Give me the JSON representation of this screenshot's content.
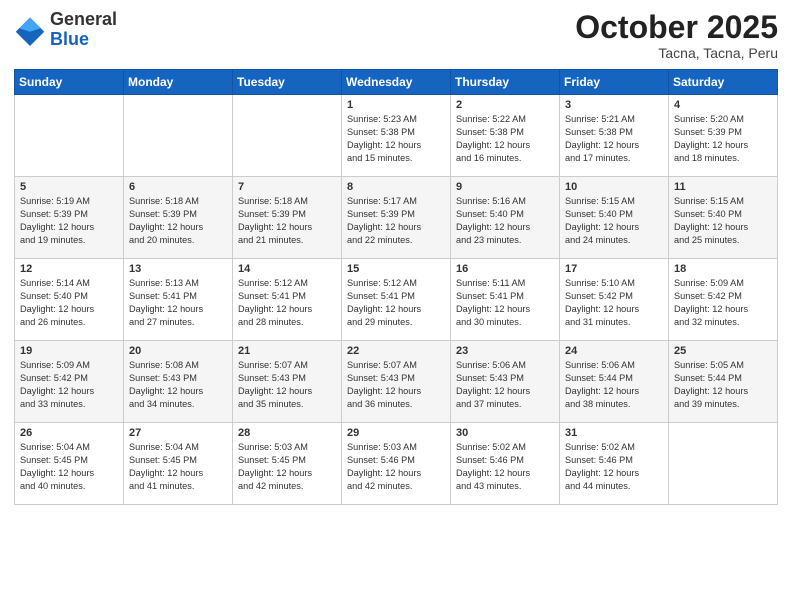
{
  "header": {
    "logo_general": "General",
    "logo_blue": "Blue",
    "month": "October 2025",
    "location": "Tacna, Tacna, Peru"
  },
  "weekdays": [
    "Sunday",
    "Monday",
    "Tuesday",
    "Wednesday",
    "Thursday",
    "Friday",
    "Saturday"
  ],
  "weeks": [
    [
      {
        "day": "",
        "info": ""
      },
      {
        "day": "",
        "info": ""
      },
      {
        "day": "",
        "info": ""
      },
      {
        "day": "1",
        "info": "Sunrise: 5:23 AM\nSunset: 5:38 PM\nDaylight: 12 hours\nand 15 minutes."
      },
      {
        "day": "2",
        "info": "Sunrise: 5:22 AM\nSunset: 5:38 PM\nDaylight: 12 hours\nand 16 minutes."
      },
      {
        "day": "3",
        "info": "Sunrise: 5:21 AM\nSunset: 5:38 PM\nDaylight: 12 hours\nand 17 minutes."
      },
      {
        "day": "4",
        "info": "Sunrise: 5:20 AM\nSunset: 5:39 PM\nDaylight: 12 hours\nand 18 minutes."
      }
    ],
    [
      {
        "day": "5",
        "info": "Sunrise: 5:19 AM\nSunset: 5:39 PM\nDaylight: 12 hours\nand 19 minutes."
      },
      {
        "day": "6",
        "info": "Sunrise: 5:18 AM\nSunset: 5:39 PM\nDaylight: 12 hours\nand 20 minutes."
      },
      {
        "day": "7",
        "info": "Sunrise: 5:18 AM\nSunset: 5:39 PM\nDaylight: 12 hours\nand 21 minutes."
      },
      {
        "day": "8",
        "info": "Sunrise: 5:17 AM\nSunset: 5:39 PM\nDaylight: 12 hours\nand 22 minutes."
      },
      {
        "day": "9",
        "info": "Sunrise: 5:16 AM\nSunset: 5:40 PM\nDaylight: 12 hours\nand 23 minutes."
      },
      {
        "day": "10",
        "info": "Sunrise: 5:15 AM\nSunset: 5:40 PM\nDaylight: 12 hours\nand 24 minutes."
      },
      {
        "day": "11",
        "info": "Sunrise: 5:15 AM\nSunset: 5:40 PM\nDaylight: 12 hours\nand 25 minutes."
      }
    ],
    [
      {
        "day": "12",
        "info": "Sunrise: 5:14 AM\nSunset: 5:40 PM\nDaylight: 12 hours\nand 26 minutes."
      },
      {
        "day": "13",
        "info": "Sunrise: 5:13 AM\nSunset: 5:41 PM\nDaylight: 12 hours\nand 27 minutes."
      },
      {
        "day": "14",
        "info": "Sunrise: 5:12 AM\nSunset: 5:41 PM\nDaylight: 12 hours\nand 28 minutes."
      },
      {
        "day": "15",
        "info": "Sunrise: 5:12 AM\nSunset: 5:41 PM\nDaylight: 12 hours\nand 29 minutes."
      },
      {
        "day": "16",
        "info": "Sunrise: 5:11 AM\nSunset: 5:41 PM\nDaylight: 12 hours\nand 30 minutes."
      },
      {
        "day": "17",
        "info": "Sunrise: 5:10 AM\nSunset: 5:42 PM\nDaylight: 12 hours\nand 31 minutes."
      },
      {
        "day": "18",
        "info": "Sunrise: 5:09 AM\nSunset: 5:42 PM\nDaylight: 12 hours\nand 32 minutes."
      }
    ],
    [
      {
        "day": "19",
        "info": "Sunrise: 5:09 AM\nSunset: 5:42 PM\nDaylight: 12 hours\nand 33 minutes."
      },
      {
        "day": "20",
        "info": "Sunrise: 5:08 AM\nSunset: 5:43 PM\nDaylight: 12 hours\nand 34 minutes."
      },
      {
        "day": "21",
        "info": "Sunrise: 5:07 AM\nSunset: 5:43 PM\nDaylight: 12 hours\nand 35 minutes."
      },
      {
        "day": "22",
        "info": "Sunrise: 5:07 AM\nSunset: 5:43 PM\nDaylight: 12 hours\nand 36 minutes."
      },
      {
        "day": "23",
        "info": "Sunrise: 5:06 AM\nSunset: 5:43 PM\nDaylight: 12 hours\nand 37 minutes."
      },
      {
        "day": "24",
        "info": "Sunrise: 5:06 AM\nSunset: 5:44 PM\nDaylight: 12 hours\nand 38 minutes."
      },
      {
        "day": "25",
        "info": "Sunrise: 5:05 AM\nSunset: 5:44 PM\nDaylight: 12 hours\nand 39 minutes."
      }
    ],
    [
      {
        "day": "26",
        "info": "Sunrise: 5:04 AM\nSunset: 5:45 PM\nDaylight: 12 hours\nand 40 minutes."
      },
      {
        "day": "27",
        "info": "Sunrise: 5:04 AM\nSunset: 5:45 PM\nDaylight: 12 hours\nand 41 minutes."
      },
      {
        "day": "28",
        "info": "Sunrise: 5:03 AM\nSunset: 5:45 PM\nDaylight: 12 hours\nand 42 minutes."
      },
      {
        "day": "29",
        "info": "Sunrise: 5:03 AM\nSunset: 5:46 PM\nDaylight: 12 hours\nand 42 minutes."
      },
      {
        "day": "30",
        "info": "Sunrise: 5:02 AM\nSunset: 5:46 PM\nDaylight: 12 hours\nand 43 minutes."
      },
      {
        "day": "31",
        "info": "Sunrise: 5:02 AM\nSunset: 5:46 PM\nDaylight: 12 hours\nand 44 minutes."
      },
      {
        "day": "",
        "info": ""
      }
    ]
  ]
}
